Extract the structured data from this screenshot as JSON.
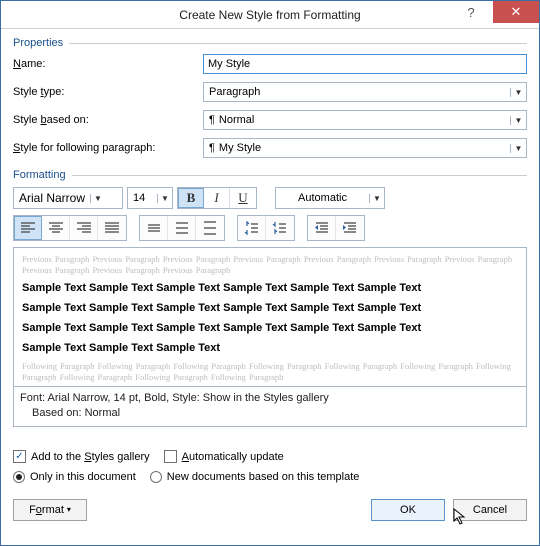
{
  "titlebar": {
    "title": "Create New Style from Formatting",
    "help": "?",
    "close": "✕"
  },
  "properties": {
    "legend": "Properties",
    "name_label_pre": "",
    "name_underline": "N",
    "name_label_post": "ame:",
    "name_value": "My Style",
    "type_label_pre": "Style ",
    "type_underline": "t",
    "type_label_post": "ype:",
    "type_value": "Paragraph",
    "based_label_pre": "Style ",
    "based_underline": "b",
    "based_label_post": "ased on:",
    "based_pilcrow": "¶",
    "based_value": "Normal",
    "following_label_pre": "",
    "following_underline": "S",
    "following_label_post": "tyle for following paragraph:",
    "following_pilcrow": "¶",
    "following_value": "My Style"
  },
  "formatting": {
    "legend": "Formatting",
    "font_name": "Arial Narrow",
    "font_size": "14",
    "bold": "B",
    "italic": "I",
    "underline": "U",
    "font_color": "Automatic"
  },
  "toolbar": {
    "align": [
      "left",
      "center",
      "right",
      "justify"
    ],
    "spacing": [
      "line-tight",
      "line-normal",
      "line-loose"
    ],
    "para": [
      "indent-less",
      "indent-more"
    ],
    "indent": [
      "outdent",
      "indent"
    ]
  },
  "preview": {
    "ghost_prev": "Previous Paragraph Previous Paragraph Previous Paragraph Previous Paragraph Previous Paragraph Previous Paragraph Previous Paragraph Previous Paragraph Previous Paragraph Previous Paragraph",
    "sample1": "Sample Text Sample Text Sample Text Sample Text Sample Text Sample Text",
    "sample2": "Sample Text Sample Text Sample Text Sample Text Sample Text Sample Text",
    "sample3": "Sample Text Sample Text Sample Text Sample Text Sample Text Sample Text",
    "sample4": "Sample Text Sample Text Sample Text",
    "ghost_next": "Following Paragraph Following Paragraph Following Paragraph Following Paragraph Following Paragraph Following Paragraph Following Paragraph Following Paragraph Following Paragraph Following Paragraph"
  },
  "description": {
    "line1": "Font: Arial Narrow, 14 pt, Bold, Style: Show in the Styles gallery",
    "line2": "Based on: Normal"
  },
  "options": {
    "add_pre": "Add to the ",
    "add_underline": "S",
    "add_post": "tyles gallery",
    "auto_underline": "A",
    "auto_post": "utomatically update",
    "only_doc": "Only in this document",
    "new_docs": "New documents based on this template"
  },
  "footer": {
    "format_pre": "F",
    "format_underline": "o",
    "format_post": "rmat",
    "caret": "▾",
    "ok": "OK",
    "cancel": "Cancel"
  }
}
